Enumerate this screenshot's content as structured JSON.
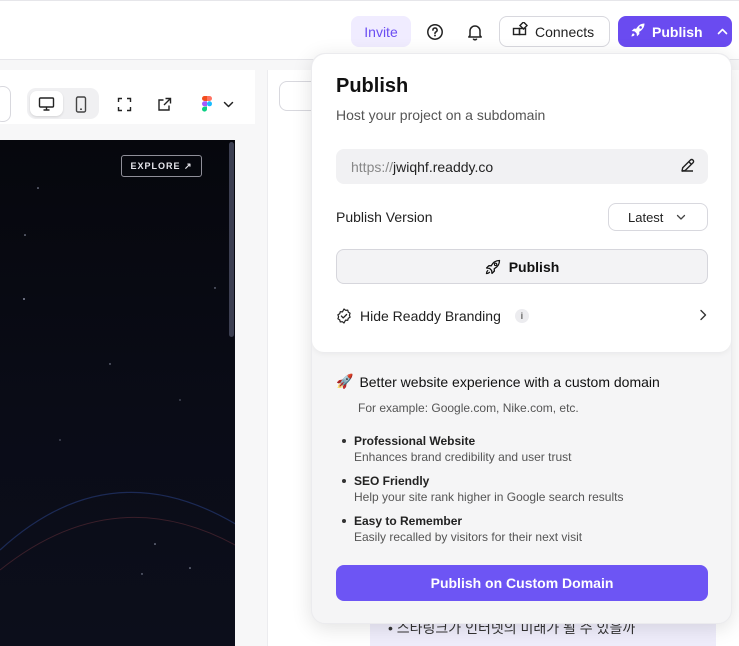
{
  "topbar": {
    "invite_label": "Invite",
    "help_icon": "help-circle-icon",
    "bell_icon": "bell-icon",
    "connects_label": "Connects",
    "publish_label": "Publish",
    "accent": "#6a4bf0"
  },
  "preview": {
    "explore_label": "EXPLORE ↗"
  },
  "popover": {
    "title": "Publish",
    "subtitle": "Host your project on a subdomain",
    "url_prefix": "https://",
    "url_domain": "jwiqhf.readdy.co",
    "version_label": "Publish Version",
    "version_value": "Latest",
    "publish_button": "Publish",
    "branding_label": "Hide Readdy Branding",
    "branding_info": "i",
    "promo_emoji": "🚀",
    "promo_title": "Better website experience with a custom domain",
    "promo_example": "For example: Google.com, Nike.com, etc.",
    "features": [
      {
        "title": "Professional Website",
        "desc": "Enhances brand credibility and user trust"
      },
      {
        "title": "SEO Friendly",
        "desc": "Help your site rank higher in Google search results"
      },
      {
        "title": "Easy to Remember",
        "desc": "Easily recalled by visitors for their next visit"
      }
    ],
    "custom_domain_button": "Publish on Custom Domain"
  },
  "chat": {
    "partial_line": "• 스타링크가 인터넷의 미래가 될 수 있을까"
  }
}
